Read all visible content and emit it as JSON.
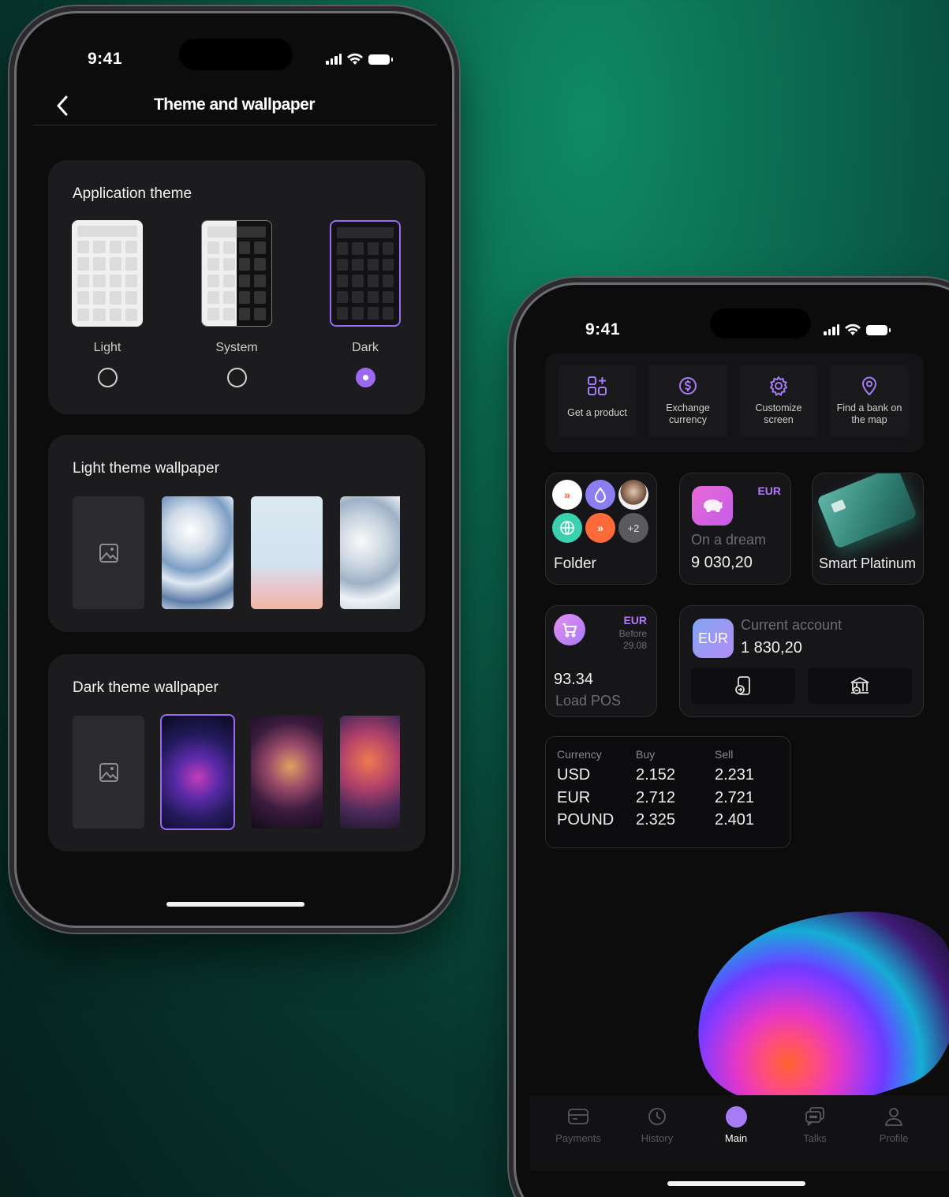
{
  "left_phone": {
    "status_time": "9:41",
    "nav_title": "Theme and wallpaper",
    "theme_section": {
      "title": "Application theme",
      "options": [
        {
          "label": "Light",
          "selected": false
        },
        {
          "label": "System",
          "selected": false
        },
        {
          "label": "Dark",
          "selected": true
        }
      ]
    },
    "light_wallpaper_title": "Light theme wallpaper",
    "dark_wallpaper_title": "Dark theme wallpaper",
    "accent_color": "#9a6af2"
  },
  "right_phone": {
    "status_time": "9:41",
    "quick_actions": [
      {
        "label": "Get a product",
        "icon": "grid-plus-icon"
      },
      {
        "label": "Exchange currency",
        "icon": "dollar-exchange-icon"
      },
      {
        "label": "Customize screen",
        "icon": "gear-icon"
      },
      {
        "label": "Find a bank on the map",
        "icon": "map-pin-icon"
      }
    ],
    "folder": {
      "label": "Folder",
      "more_count": "+2"
    },
    "dream": {
      "currency": "EUR",
      "name": "On a dream",
      "amount": "9 030,20"
    },
    "platinum": {
      "name": "Smart Platinum"
    },
    "pos": {
      "currency": "EUR",
      "before_label": "Before",
      "before_date": "29.08",
      "amount": "93.34",
      "name": "Load POS"
    },
    "current_account": {
      "badge": "EUR",
      "name": "Current account",
      "amount": "1 830,20"
    },
    "fx_table": {
      "headers": [
        "Currency",
        "Buy",
        "Sell"
      ],
      "rows": [
        {
          "currency": "USD",
          "buy": "2.152",
          "sell": "2.231"
        },
        {
          "currency": "EUR",
          "buy": "2.712",
          "sell": "2.721"
        },
        {
          "currency": "POUND",
          "buy": "2.325",
          "sell": "2.401"
        }
      ]
    },
    "tabs": [
      {
        "label": "Payments",
        "active": false
      },
      {
        "label": "History",
        "active": false
      },
      {
        "label": "Main",
        "active": true
      },
      {
        "label": "Talks",
        "active": false
      },
      {
        "label": "Profile",
        "active": false
      }
    ]
  }
}
